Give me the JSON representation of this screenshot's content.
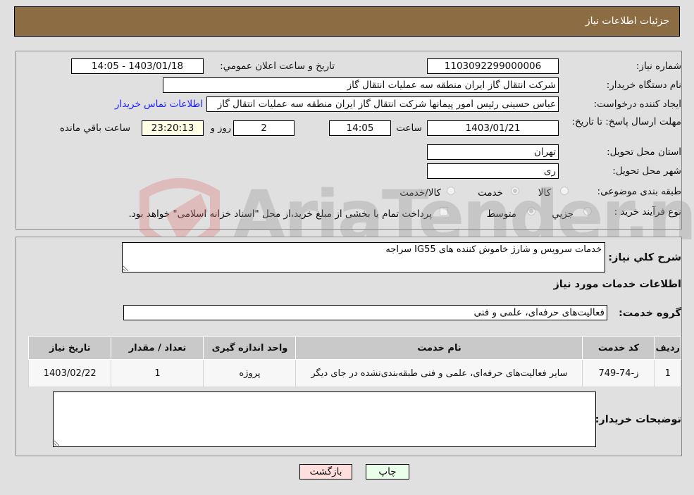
{
  "header": {
    "title": "جزئیات اطلاعات نیاز"
  },
  "form": {
    "need_number_label": "شماره نیاز:",
    "need_number": "1103092299000006",
    "announce_label": "تاریخ و ساعت اعلان عمومي:",
    "announce_value": "1403/01/18 - 14:05",
    "buyer_org_label": "نام دستگاه خريدار:",
    "buyer_org": "شرکت انتقال گاز ایران منطقه سه عملیات انتقال گاز",
    "requester_label": "ايجاد کننده درخواست:",
    "requester": "عباس حسینی رئیس امور پیمانها شرکت انتقال گاز ایران منطقه سه عملیات انتقال گاز",
    "contact_link": "اطلاعات تماس خریدار",
    "deadline_label": "مهلت ارسال پاسخ: تا تاریخ:",
    "deadline_date": "1403/01/21",
    "time_label": "ساعت",
    "deadline_time": "14:05",
    "days_value": "2",
    "days_label": "روز و",
    "remaining_time": "23:20:13",
    "remaining_label": "ساعت باقي مانده",
    "province_label": "استان محل تحویل:",
    "province": "تهران",
    "city_label": "شهر محل تحویل:",
    "city": "ری",
    "category_label": "طبقه بندی موضوعی:",
    "category_options": [
      {
        "label": "کالا",
        "checked": false
      },
      {
        "label": "خدمت",
        "checked": true
      },
      {
        "label": "کالا/خدمت",
        "checked": false
      }
    ],
    "process_label": "نوع فرآيند خريد :",
    "process_options": [
      {
        "label": "جزيي",
        "checked": false
      },
      {
        "label": "متوسط",
        "checked": true
      }
    ],
    "treasury_note": "پرداخت تمام یا بخشی از مبلغ خرید،از محل \"اسناد خزانه اسلامی\" خواهد بود."
  },
  "details": {
    "general_desc_label": "شرح کلي نياز:",
    "general_desc": "خدمات سرویس و شارژ خاموش کننده های IG55 سراجه",
    "services_heading": "اطلاعات خدمات مورد نیاز",
    "service_group_label": "گروه خدمت:",
    "service_group": "فعالیت‌های حرفه‌ای، علمی و فنی",
    "table": {
      "headers": [
        "رديف",
        "کد خدمت",
        "نام خدمت",
        "واحد اندازه گیری",
        "تعداد / مقدار",
        "تاریخ نیاز"
      ],
      "rows": [
        [
          "1",
          "ز-74-749",
          "سایر فعالیت‌های حرفه‌ای، علمی و فنی طبقه‌بندی‌نشده در جای دیگر",
          "پروژه",
          "1",
          "1403/02/22"
        ]
      ]
    },
    "buyer_notes_label": "توضیحات خریدار:",
    "buyer_notes": ""
  },
  "buttons": {
    "print": "چاپ",
    "back": "بازگشت"
  },
  "watermark": {
    "text": "AriaTender.neT"
  },
  "colors": {
    "header_bg": "#8c6d43",
    "print_bg": "#eaffea",
    "back_bg": "#ffdede",
    "link": "#1a1aff"
  }
}
